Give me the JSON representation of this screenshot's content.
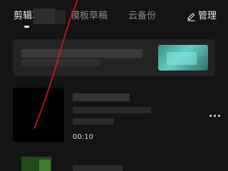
{
  "tabs": {
    "drafts": "剪辑草稿",
    "templates": "模板草稿",
    "cloud": "云备份"
  },
  "header": {
    "manage_label": "管理",
    "manage_icon": "edit-icon"
  },
  "drafts": [
    {
      "duration": "00:10"
    }
  ],
  "icons": {
    "more": "more-horizontal-icon"
  },
  "colors": {
    "background": "#141414",
    "annotation": "#d51616",
    "banner_accent": "#5fd1c6"
  }
}
